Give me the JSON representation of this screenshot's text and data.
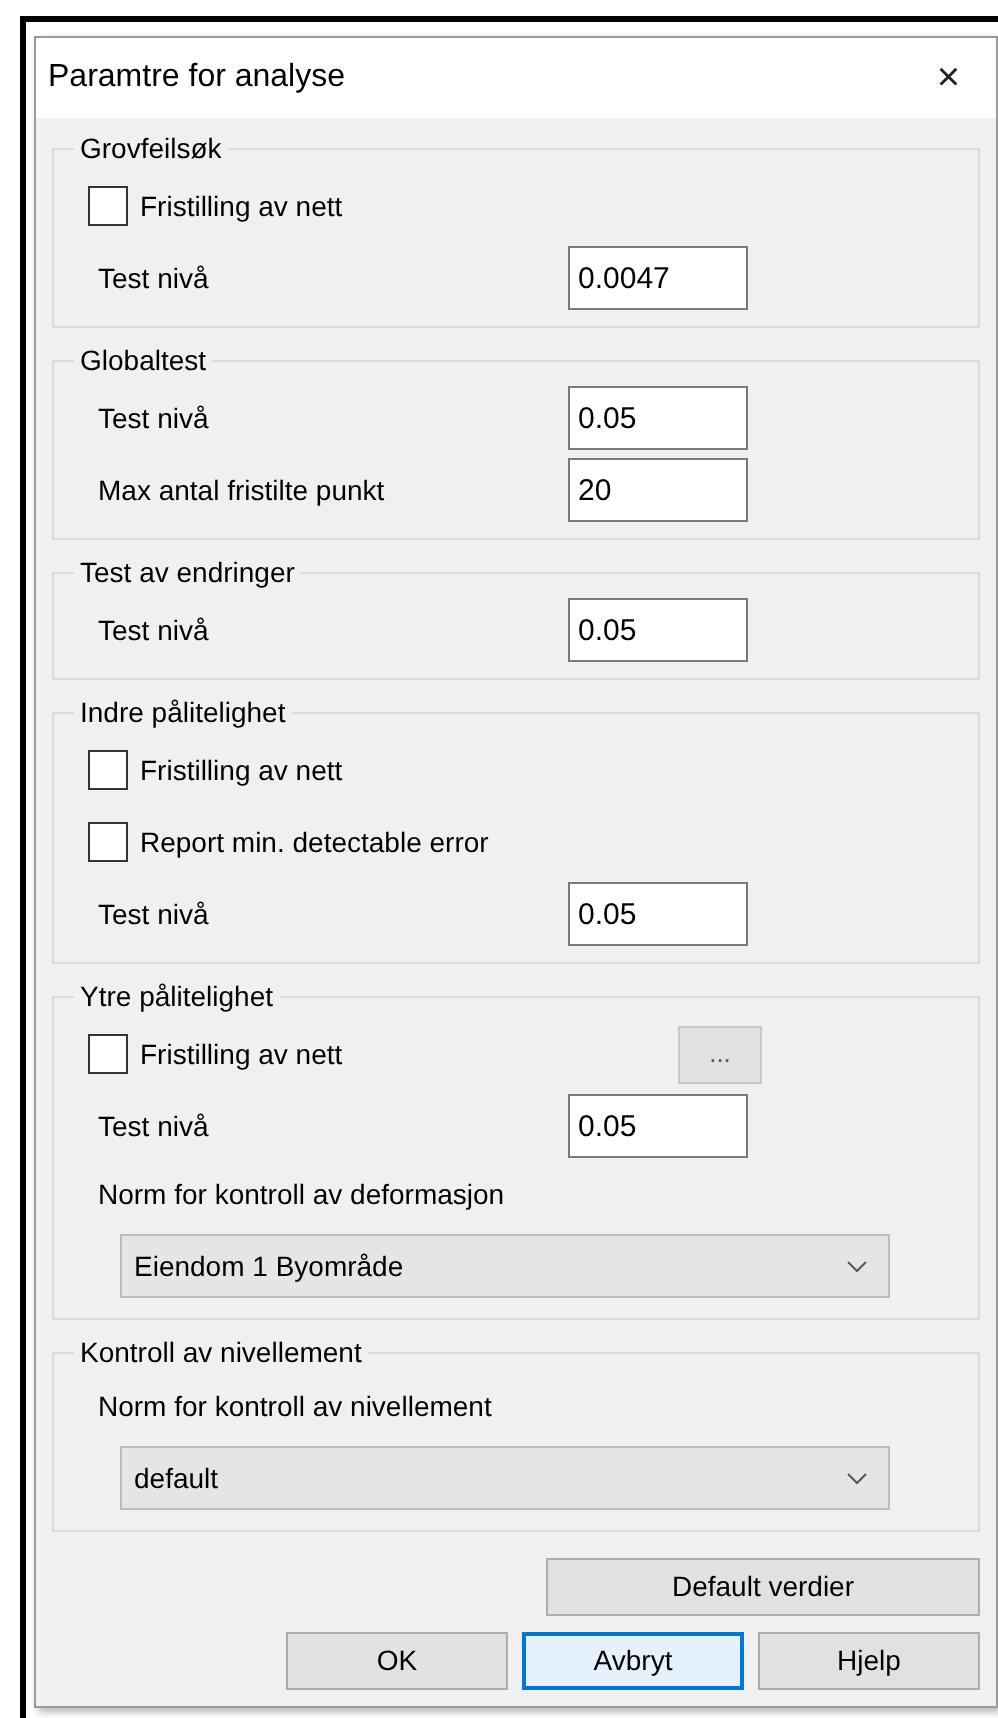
{
  "window": {
    "title": "Paramtre for analyse",
    "close": "×"
  },
  "groups": [
    {
      "title": "Grovfeilsøk",
      "rows": [
        {
          "kind": "checkbox",
          "label": "Fristilling av nett",
          "checked": false
        },
        {
          "kind": "input",
          "label": "Test nivå",
          "value": "0.0047"
        }
      ]
    },
    {
      "title": "Globaltest",
      "rows": [
        {
          "kind": "input",
          "label": "Test nivå",
          "value": "0.05"
        },
        {
          "kind": "input",
          "label": "Max antal fristilte punkt",
          "value": "20"
        }
      ]
    },
    {
      "title": "Test av endringer",
      "rows": [
        {
          "kind": "input",
          "label": "Test nivå",
          "value": "0.05"
        }
      ]
    },
    {
      "title": "Indre pålitelighet",
      "rows": [
        {
          "kind": "checkbox",
          "label": "Fristilling av nett",
          "checked": false
        },
        {
          "kind": "checkbox",
          "label": "Report min. detectable error",
          "checked": false
        },
        {
          "kind": "input",
          "label": "Test nivå",
          "value": "0.05"
        }
      ]
    },
    {
      "title": "Ytre pålitelighet",
      "rows": [
        {
          "kind": "checkbox",
          "label": "Fristilling av nett",
          "checked": false,
          "button": "..."
        },
        {
          "kind": "input",
          "label": "Test nivå",
          "value": "0.05"
        },
        {
          "kind": "label",
          "label": "Norm for kontroll av deformasjon"
        },
        {
          "kind": "dropdown",
          "value": "Eiendom 1 Byområde"
        }
      ]
    },
    {
      "title": "Kontroll av nivellement",
      "rows": [
        {
          "kind": "label",
          "label": "Norm for kontroll av nivellement"
        },
        {
          "kind": "dropdown",
          "value": "default"
        }
      ]
    }
  ],
  "default_button": "Default verdier",
  "buttons": [
    {
      "label": "OK",
      "focused": false
    },
    {
      "label": "Avbryt",
      "focused": true
    },
    {
      "label": "Hjelp",
      "focused": false
    }
  ]
}
